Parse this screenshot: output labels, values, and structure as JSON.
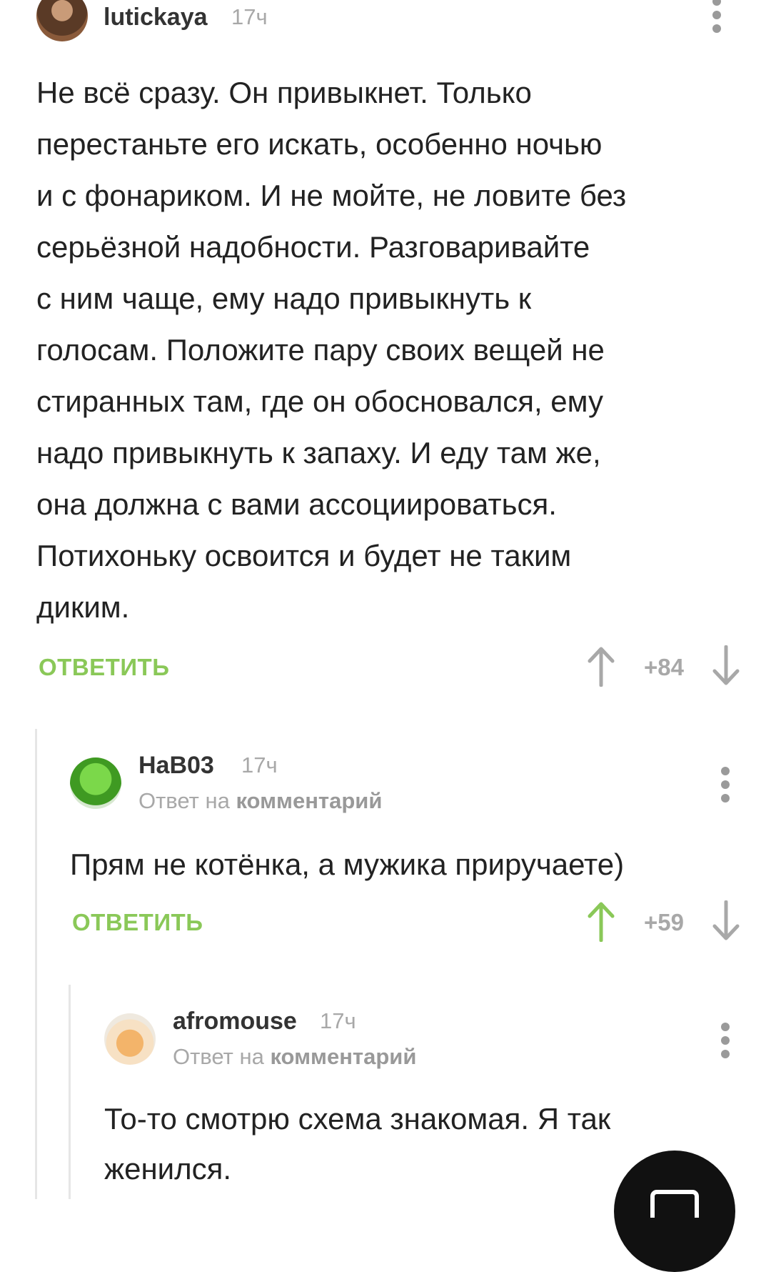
{
  "comments": [
    {
      "author": "lutickaya",
      "time": "17ч",
      "lines": [
        "Не всё сразу. Он привыкнет. Только",
        "перестаньте его искать, особенно ночью",
        "и с фонариком. И не мойте, не ловите без",
        "серьёзной надобности. Разговаривайте",
        "с ним чаще, ему надо привыкнуть к",
        "голосам. Положите пару своих вещей не",
        "стиранных там, где он обосновался, ему",
        "надо привыкнуть к запаху. И еду там же,",
        "она должна с вами ассоциироваться.",
        "Потихоньку освоится и будет не таким",
        "диким."
      ],
      "reply_label": "ОТВЕТИТЬ",
      "rating": "+84",
      "upvoted": false
    },
    {
      "author": "HaB03",
      "time": "17ч",
      "reply_prefix": "Ответ на",
      "reply_target": "комментарий",
      "lines": [
        "Прям не котёнка, а мужика приручаете)"
      ],
      "reply_label": "ОТВЕТИТЬ",
      "rating": "+59",
      "upvoted": true
    },
    {
      "author": "afromouse",
      "time": "17ч",
      "reply_prefix": "Ответ на",
      "reply_target": "комментарий",
      "lines": [
        "То-то смотрю схема знакомая. Я так",
        "женился."
      ]
    }
  ],
  "colors": {
    "accent_green": "#8ac858",
    "muted_gray": "#a8a8a8",
    "text": "#222222",
    "fab": "#111111"
  },
  "icons": [
    "more-vertical-icon",
    "arrow-up-icon",
    "arrow-down-icon",
    "compose-icon"
  ]
}
